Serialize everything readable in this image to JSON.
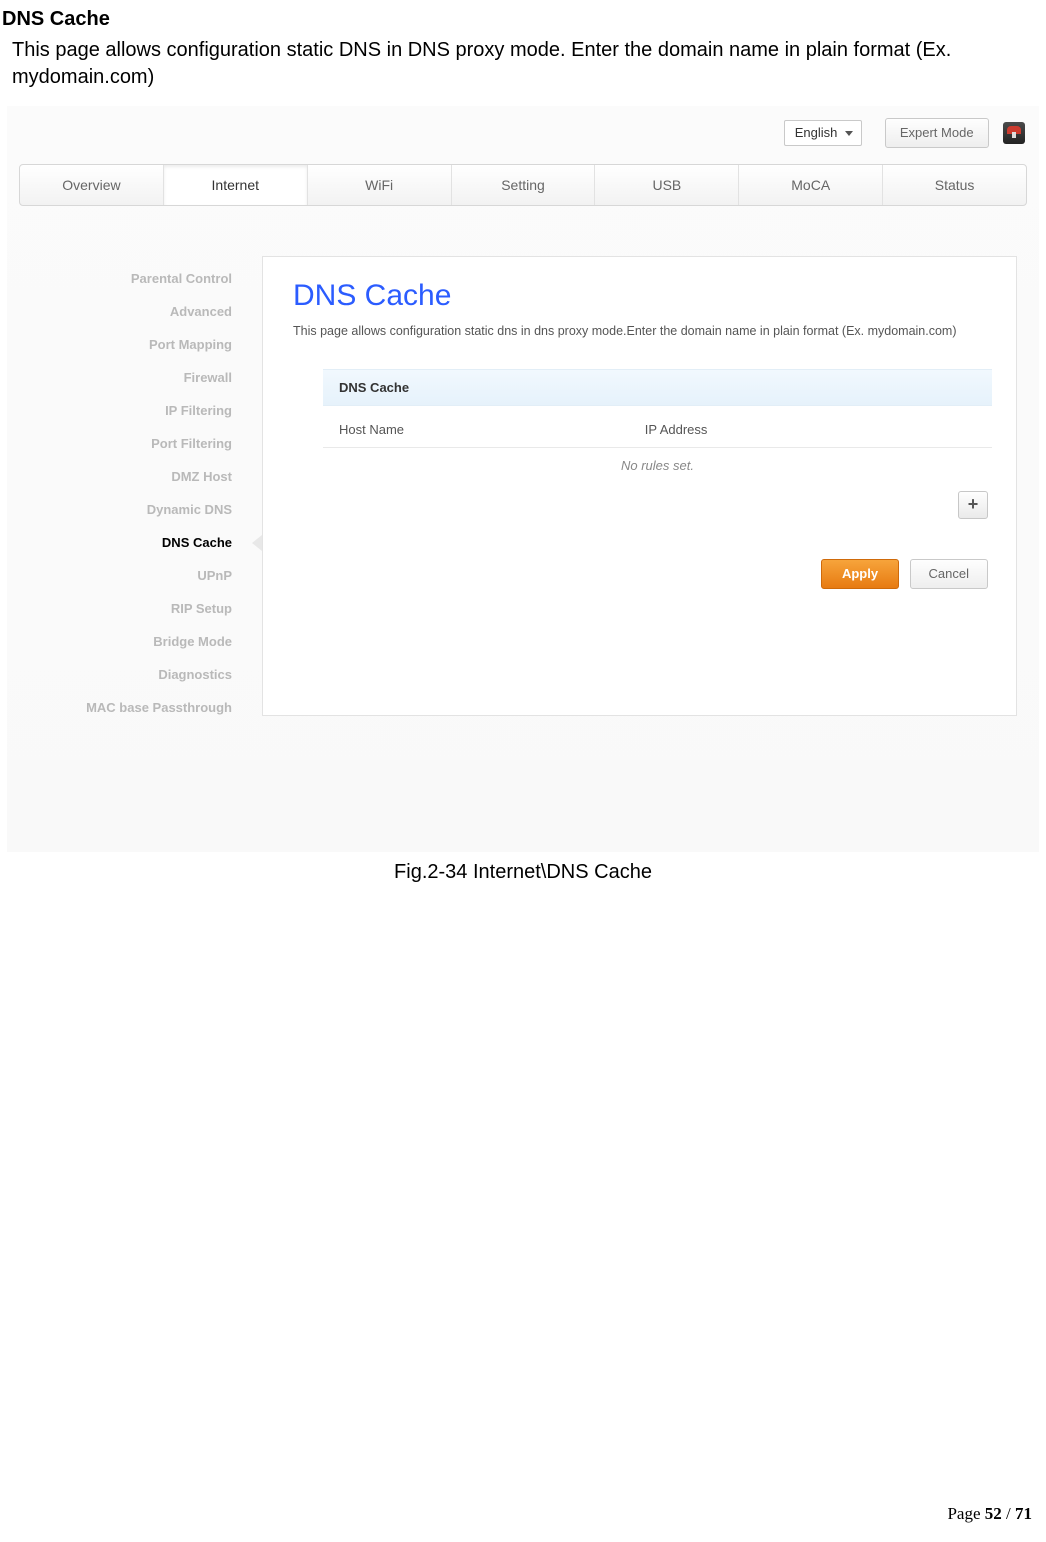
{
  "doc": {
    "heading": "DNS Cache",
    "intro": "This page allows configuration static DNS in DNS proxy mode. Enter the domain name in plain format (Ex. mydomain.com)",
    "caption": "Fig.2-34 Internet\\DNS Cache",
    "page_label": "Page ",
    "page_current": "52",
    "page_sep": " / ",
    "page_total": "71"
  },
  "topbar": {
    "language": "English",
    "expert": "Expert Mode"
  },
  "nav": {
    "tabs": [
      "Overview",
      "Internet",
      "WiFi",
      "Setting",
      "USB",
      "MoCA",
      "Status"
    ],
    "active_index": 1
  },
  "sidebar": {
    "items": [
      "Parental Control",
      "Advanced",
      "Port Mapping",
      "Firewall",
      "IP Filtering",
      "Port Filtering",
      "DMZ Host",
      "Dynamic DNS",
      "DNS Cache",
      "UPnP",
      "RIP Setup",
      "Bridge Mode",
      "Diagnostics",
      "MAC base Passthrough"
    ],
    "active_index": 8
  },
  "panel": {
    "title": "DNS Cache",
    "desc": "This page allows configuration static dns in dns proxy mode.Enter the domain name in plain format (Ex. mydomain.com)",
    "section_head": "DNS Cache",
    "col_host": "Host Name",
    "col_ip": "IP Address",
    "empty": "No rules set.",
    "add_glyph": "+",
    "apply": "Apply",
    "cancel": "Cancel"
  }
}
